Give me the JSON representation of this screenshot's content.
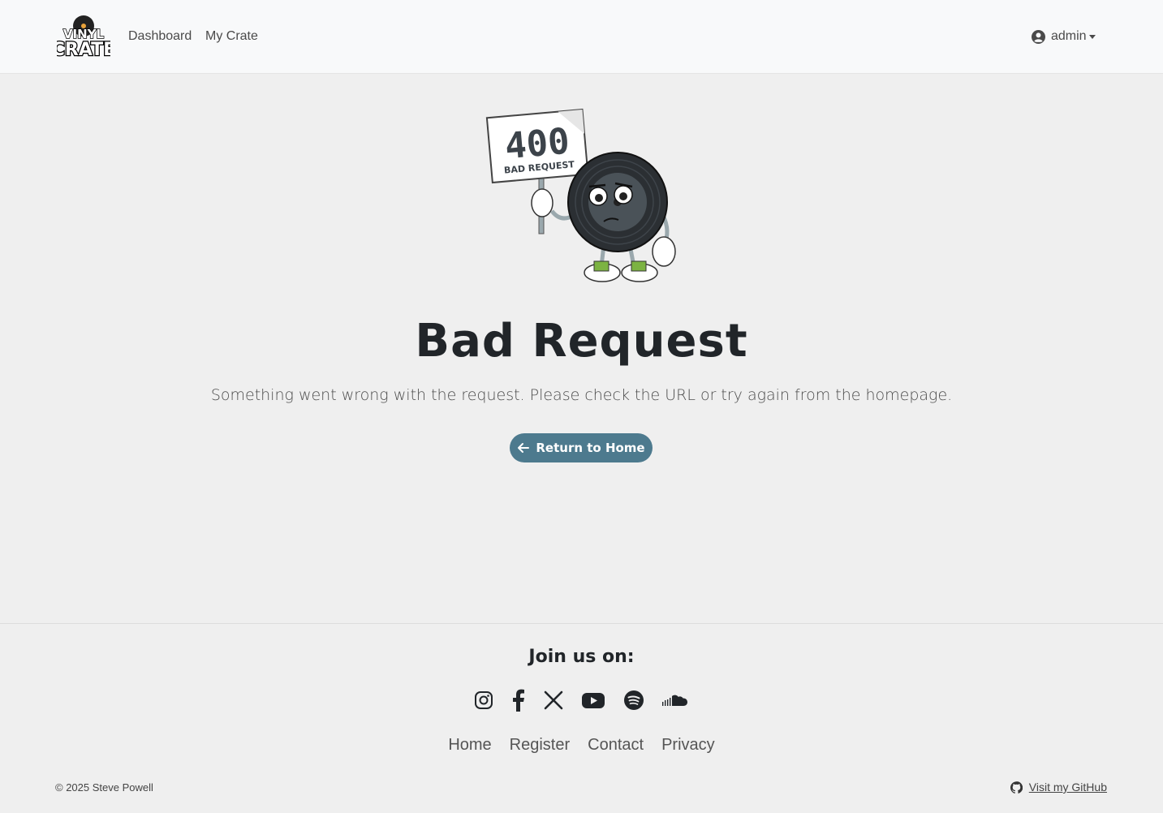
{
  "app": {
    "logo_text_top": "VINYL",
    "logo_text_bottom": "CRATE"
  },
  "nav": {
    "dashboard_label": "Dashboard",
    "crate_label": "My Crate",
    "user_label": "admin"
  },
  "error": {
    "sign_code": "400",
    "sign_text": "BAD REQUEST",
    "title": "Bad Request",
    "message": "Something went wrong with the request. Please check the URL or try again from the homepage.",
    "button_label": "Return to Home"
  },
  "footer": {
    "join_label": "Join us on:",
    "social_icons": [
      "instagram-icon",
      "facebook-icon",
      "x-icon",
      "youtube-icon",
      "spotify-icon",
      "soundcloud-icon"
    ],
    "links": [
      "Home",
      "Register",
      "Contact",
      "Privacy"
    ],
    "copyright": "© 2025 Steve Powell",
    "github_label": "Visit my GitHub"
  },
  "colors": {
    "accent": "#4d7a8e",
    "background": "#efefef",
    "navbar": "#f8f9fa",
    "text": "#212529"
  }
}
